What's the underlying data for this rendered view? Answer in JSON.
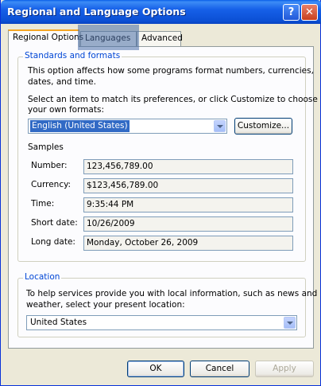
{
  "window": {
    "title": "Regional and Language Options",
    "help_glyph": "?",
    "close_glyph": "✕"
  },
  "tabs": [
    {
      "label": "Regional Options"
    },
    {
      "label": "Languages"
    },
    {
      "label": "Advanced"
    }
  ],
  "standards": {
    "legend": "Standards and formats",
    "description_line1": "This option affects how some programs format numbers, currencies,",
    "description_line2": "dates, and time.",
    "select_line1": "Select an item to match its preferences, or click Customize to choose",
    "select_line2": "your own formats:",
    "selected_format": "English (United States)",
    "customize_label": "Customize...",
    "samples_heading": "Samples",
    "samples": [
      {
        "label": "Number:",
        "value": "123,456,789.00"
      },
      {
        "label": "Currency:",
        "value": "$123,456,789.00"
      },
      {
        "label": "Time:",
        "value": "9:35:44 PM"
      },
      {
        "label": "Short date:",
        "value": "10/26/2009"
      },
      {
        "label": "Long date:",
        "value": "Monday, October 26, 2009"
      }
    ]
  },
  "location": {
    "legend": "Location",
    "description_line1": "To help services provide you with local information, such as news and",
    "description_line2": "weather, select your present location:",
    "selected_location": "United States"
  },
  "footer": {
    "ok_label": "OK",
    "cancel_label": "Cancel",
    "apply_label": "Apply"
  }
}
